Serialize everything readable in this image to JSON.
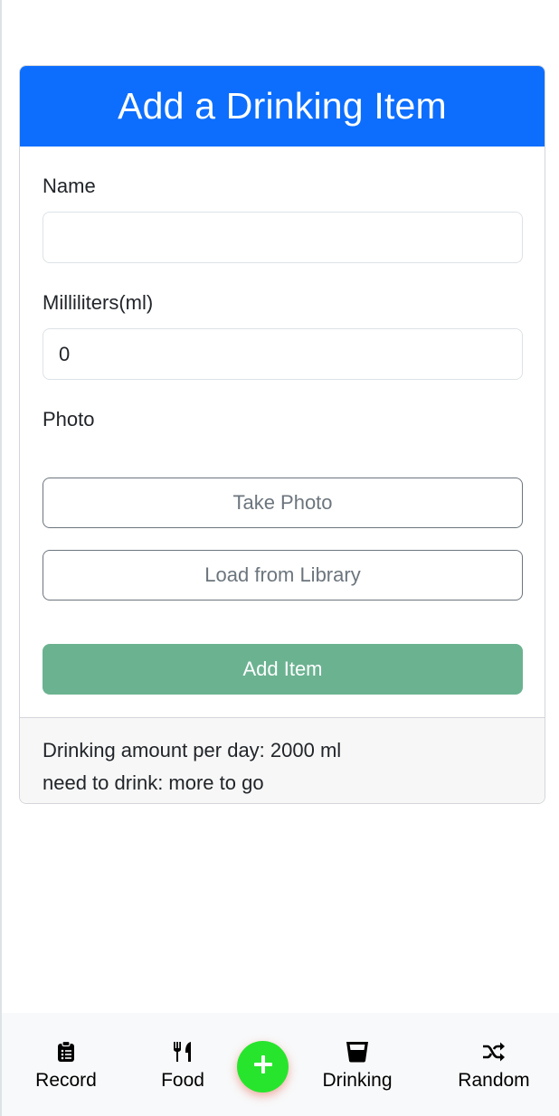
{
  "card": {
    "title": "Add a Drinking Item"
  },
  "form": {
    "name_label": "Name",
    "name_value": "",
    "ml_label": "Milliliters(ml)",
    "ml_value": "0",
    "photo_label": "Photo",
    "take_photo_label": "Take Photo",
    "load_library_label": "Load from Library",
    "add_item_label": "Add Item"
  },
  "footer": {
    "daily_amount": "Drinking amount per day: 2000 ml",
    "need_to_drink": "need to drink: more to go"
  },
  "bottom_nav": {
    "items": [
      {
        "label": "Record",
        "icon": "clipboard-icon"
      },
      {
        "label": "Food",
        "icon": "utensils-icon"
      },
      {
        "label": "Drinking",
        "icon": "glass-icon"
      },
      {
        "label": "Random",
        "icon": "shuffle-icon"
      }
    ],
    "fab_icon": "plus-icon"
  },
  "colors": {
    "header": "#0d6efd",
    "add_button": "#6bb291",
    "fab": "#27e52d"
  }
}
